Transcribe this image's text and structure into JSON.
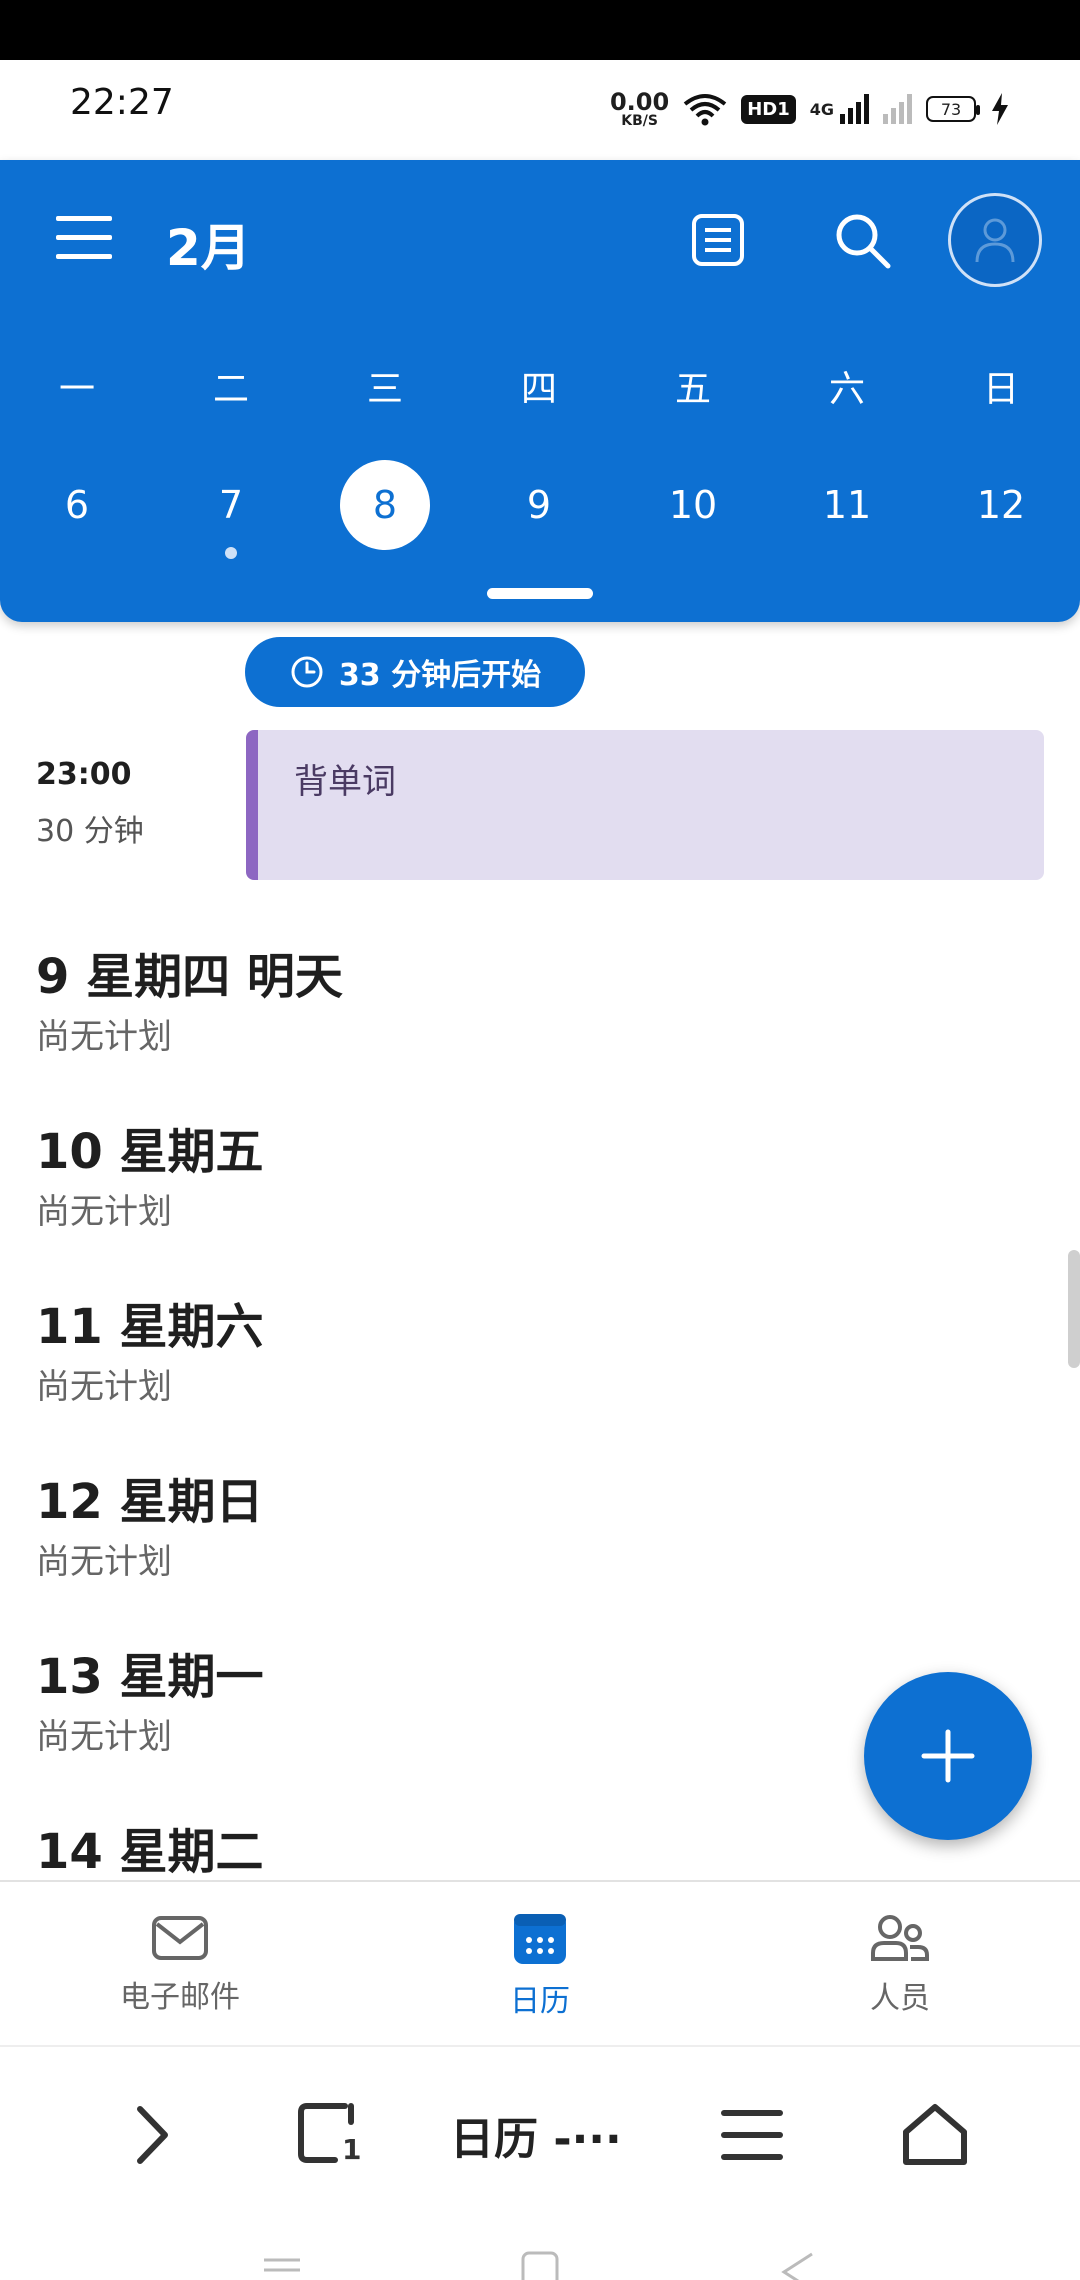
{
  "status_bar": {
    "time": "22:27",
    "speed_value": "0.00",
    "speed_unit": "KB/S",
    "hd_label": "HD1",
    "network_label": "4G",
    "battery_level": "73"
  },
  "header": {
    "month_title": "2月",
    "weekdays": [
      "一",
      "二",
      "三",
      "四",
      "五",
      "六",
      "日"
    ],
    "dates": [
      "6",
      "7",
      "8",
      "9",
      "10",
      "11",
      "12"
    ],
    "selected_date": "8",
    "event_dot_date": "7"
  },
  "schedule": {
    "countdown": "33 分钟后开始",
    "event": {
      "time": "23:00",
      "duration": "30 分钟",
      "title": "背单词",
      "color": "#8d67c2"
    },
    "days": [
      {
        "title": "9 星期四  明天",
        "subtitle": "尚无计划"
      },
      {
        "title": "10 星期五",
        "subtitle": "尚无计划"
      },
      {
        "title": "11 星期六",
        "subtitle": "尚无计划"
      },
      {
        "title": "12 星期日",
        "subtitle": "尚无计划"
      },
      {
        "title": "13 星期一",
        "subtitle": "尚无计划"
      },
      {
        "title": "14 星期二",
        "subtitle": ""
      }
    ]
  },
  "bottom_nav": {
    "items": [
      {
        "label": "电子邮件",
        "icon": "mail-icon"
      },
      {
        "label": "日历",
        "icon": "calendar-icon",
        "active": true
      },
      {
        "label": "人员",
        "icon": "people-icon"
      }
    ]
  },
  "browser_bar": {
    "title": "日历 -···",
    "tab_count": "1"
  },
  "colors": {
    "primary": "#0d70d2",
    "event_bg": "#e2ddf0",
    "event_accent": "#8d67c2"
  }
}
